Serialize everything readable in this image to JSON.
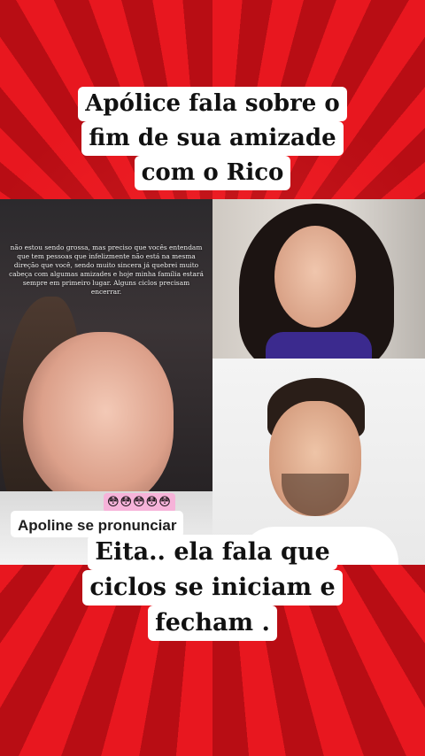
{
  "headline_top": {
    "lines": [
      "Apólice fala sobre o",
      "fim de sua amizade",
      "com o Rico"
    ]
  },
  "story": {
    "text": "não estou sendo grossa, mas preciso que vocês entendam que tem pessoas que infelizmente não está na mesma direção que você, sendo muito sincera já quebrei muito cabeça com algumas amizades e hoje minha família estará sempre em primeiro lugar. Alguns ciclos precisam encerrar.",
    "emojis": "😳😳😳😳😳",
    "caption": "Apoline se pronunciar"
  },
  "headline_bottom": {
    "lines": [
      "Eita.. ela fala que",
      "ciclos se iniciam e",
      "fecham ."
    ]
  },
  "colors": {
    "background": "#d9141c",
    "ray_dark": "#b80d14",
    "caption_bg": "#ffffff",
    "emoji_bg": "#f6b3d9"
  }
}
